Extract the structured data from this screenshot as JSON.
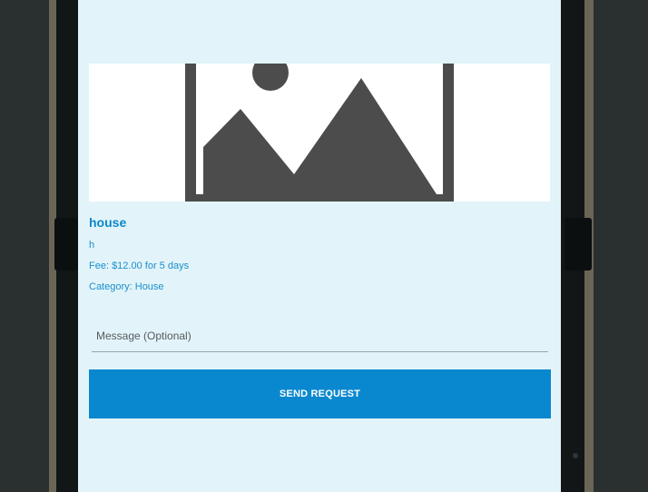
{
  "listing": {
    "title": "house",
    "description": "h",
    "fee": "Fee: $12.00 for 5 days",
    "category": "Category: House",
    "image_icon": "image-placeholder-icon"
  },
  "request_form": {
    "message_placeholder": "Message (Optional)",
    "message_value": "",
    "send_label": "SEND REQUEST"
  },
  "colors": {
    "screen_background": "#e2f4f9",
    "accent": "#0a88cf",
    "text_accent": "#1a8fcf",
    "placeholder_icon": "#4c4c4c",
    "device_frame": "#23282a"
  }
}
